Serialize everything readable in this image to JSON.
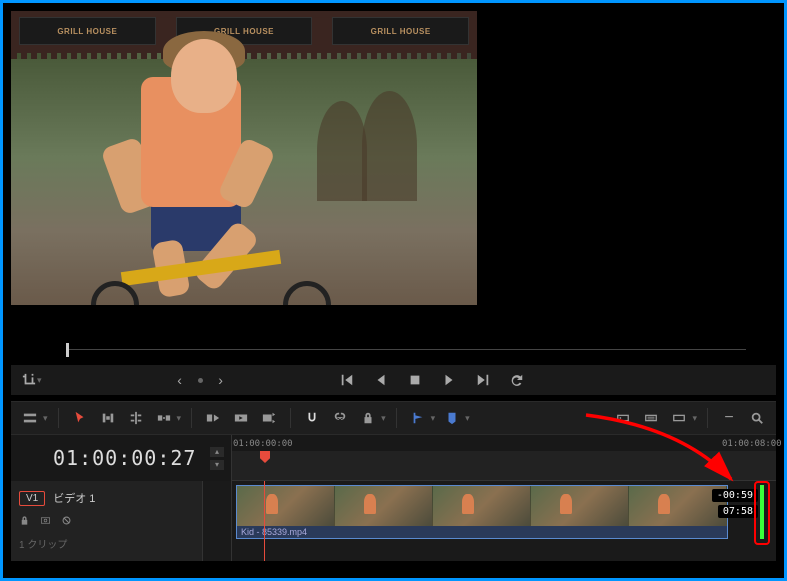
{
  "viewer": {
    "awning_signs": [
      "GRILL HOUSE",
      "GRILL HOUSE",
      "GRILL HOUSE"
    ]
  },
  "transport": {
    "crop_label": "crop",
    "nav_prev": "‹",
    "nav_dot": "•",
    "nav_next": "›"
  },
  "toolbar": {
    "marker_color_1": "#4a7ad0",
    "marker_color_2": "#4a7ad0"
  },
  "timecode": "01:00:00:27",
  "ruler": {
    "ticks": [
      {
        "pos": 1,
        "label": "01:00:00:00"
      },
      {
        "pos": 490,
        "label": "01:00:08:00"
      }
    ]
  },
  "track": {
    "badge": "V1",
    "name": "ビデオ 1",
    "clip_count": "1 クリップ",
    "lock_icon": "lock",
    "link_icon": "link"
  },
  "clip": {
    "filename": "Kid - 85339.mp4",
    "trim_remaining": "-00:59",
    "trim_total": "07:58"
  }
}
